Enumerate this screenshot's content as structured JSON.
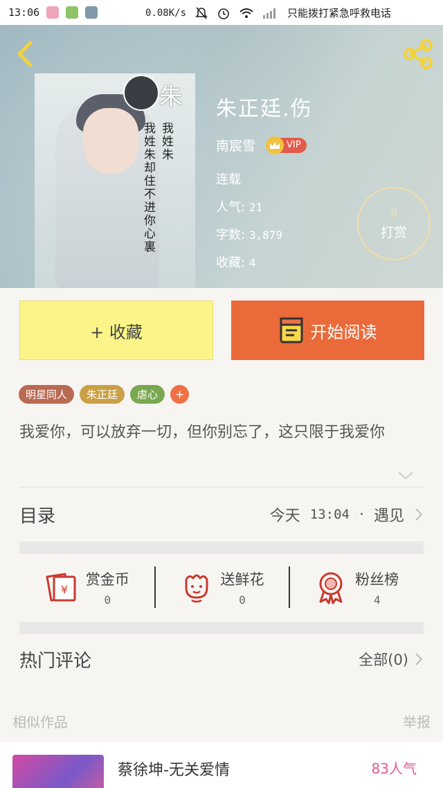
{
  "status_bar": {
    "time": "13:06",
    "speed": "0.08K/s",
    "carrier": "只能拨打紧急呼救电话"
  },
  "book": {
    "cover_text_big": "朱",
    "cover_text_line1": "我姓朱",
    "cover_text_line2": "我姓朱却住不进你心裏",
    "title": "朱正廷.伤",
    "author": "南宸雪",
    "vip": "VIP",
    "status": "连载",
    "popularity_label": "人气:",
    "popularity": "21",
    "words_label": "字数:",
    "words": "3,879",
    "favorites_label": "收藏:",
    "favorites": "4"
  },
  "tip": {
    "count": "0",
    "label": "打赏"
  },
  "actions": {
    "favorite": "+ 收藏",
    "read": "开始阅读"
  },
  "tags": [
    {
      "label": "明星同人",
      "color": "#b96a53"
    },
    {
      "label": "朱正廷",
      "color": "#c9a045"
    },
    {
      "label": "虐心",
      "color": "#79a84f"
    },
    {
      "label": "+",
      "color": "#f07046"
    }
  ],
  "description": "我爱你，可以放弃一切，但你别忘了，这只限于我爱你",
  "toc": {
    "label": "目录",
    "day": "今天",
    "time": "13:04",
    "sep": "·",
    "chapter": "遇见"
  },
  "stats": [
    {
      "name": "赏金币",
      "value": "0",
      "icon": "coin-envelope-icon"
    },
    {
      "name": "送鲜花",
      "value": "0",
      "icon": "flower-icon"
    },
    {
      "name": "粉丝榜",
      "value": "4",
      "icon": "medal-icon"
    }
  ],
  "comments": {
    "label": "热门评论",
    "all": "全部(0)"
  },
  "similar": {
    "label": "相似作品",
    "report": "举报"
  },
  "similar_item": {
    "title": "蔡徐坤-无关爱情",
    "popularity": "83人气"
  },
  "colors": {
    "accent": "#ea6a3a",
    "fav_button": "#fbf589",
    "tip_ring": "#f3dca7"
  }
}
